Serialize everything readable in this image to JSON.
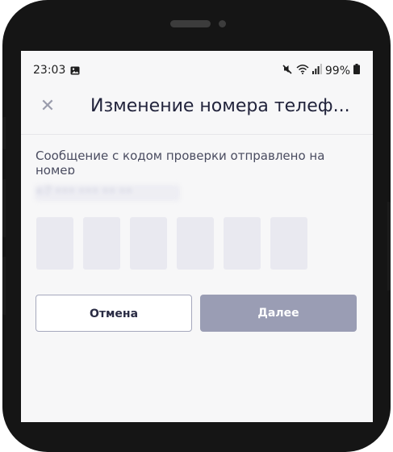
{
  "status_bar": {
    "time": "23:03",
    "battery": "99%",
    "icons": [
      "image-icon",
      "mute-icon",
      "wifi-icon",
      "signal-icon",
      "battery-icon"
    ]
  },
  "header": {
    "title": "Изменение номера телеф...",
    "close_icon": "✕"
  },
  "content": {
    "message": "Сообщение с кодом проверки отправлено на номер",
    "phone_number": "+7 ••• ••• •• ••"
  },
  "code_inputs": [
    "",
    "",
    "",
    "",
    "",
    ""
  ],
  "buttons": {
    "cancel_label": "Отмена",
    "next_label": "Далее"
  },
  "colors": {
    "accent_disabled": "#9a9db4",
    "text_dark": "#22243c",
    "code_box_bg": "#e9e9f0"
  }
}
